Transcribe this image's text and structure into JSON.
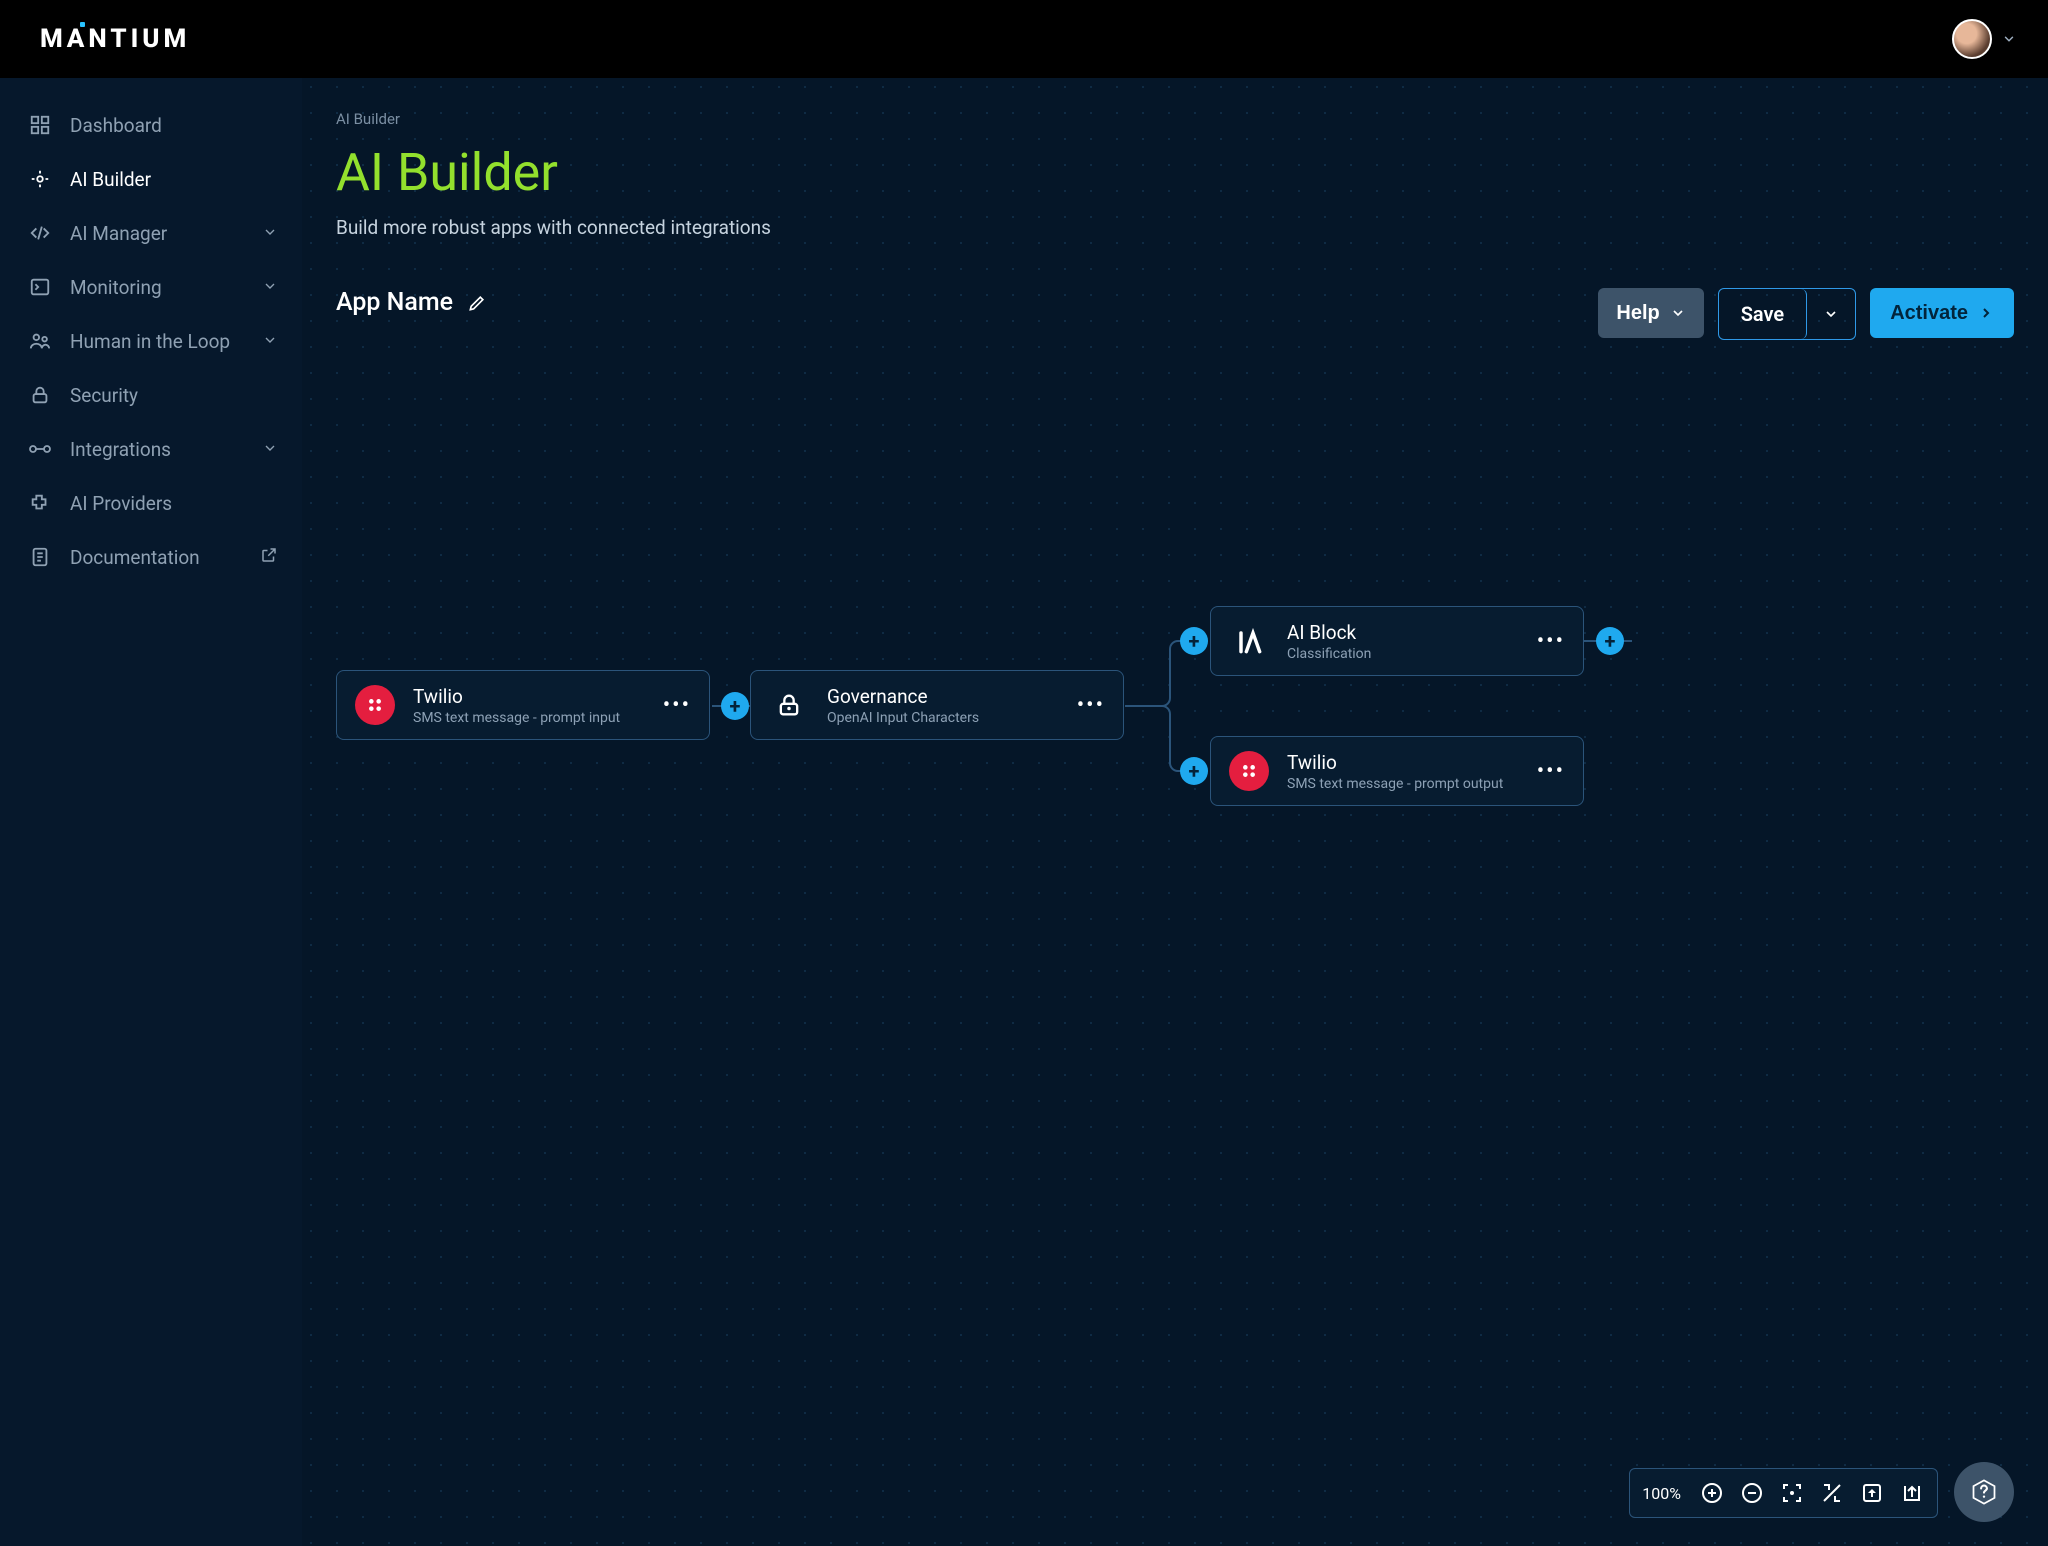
{
  "brand": "MANTIUM",
  "sidebar": {
    "items": [
      {
        "label": "Dashboard"
      },
      {
        "label": "AI Builder"
      },
      {
        "label": "AI Manager"
      },
      {
        "label": "Monitoring"
      },
      {
        "label": "Human in the Loop"
      },
      {
        "label": "Security"
      },
      {
        "label": "Integrations"
      },
      {
        "label": "AI Providers"
      },
      {
        "label": "Documentation"
      }
    ]
  },
  "breadcrumb": "AI Builder",
  "page": {
    "title": "AI Builder",
    "subtitle": "Build more robust apps with connected integrations",
    "app_name": "App Name"
  },
  "actions": {
    "help": "Help",
    "save": "Save",
    "activate": "Activate"
  },
  "nodes": {
    "n1": {
      "title": "Twilio",
      "sub": "SMS text message - prompt input"
    },
    "n2": {
      "title": "Governance",
      "sub": "OpenAI Input Characters"
    },
    "n3": {
      "title": "AI Block",
      "sub": "Classification"
    },
    "n4": {
      "title": "Twilio",
      "sub": "SMS text message - prompt output"
    }
  },
  "zoom": {
    "level": "100%"
  }
}
